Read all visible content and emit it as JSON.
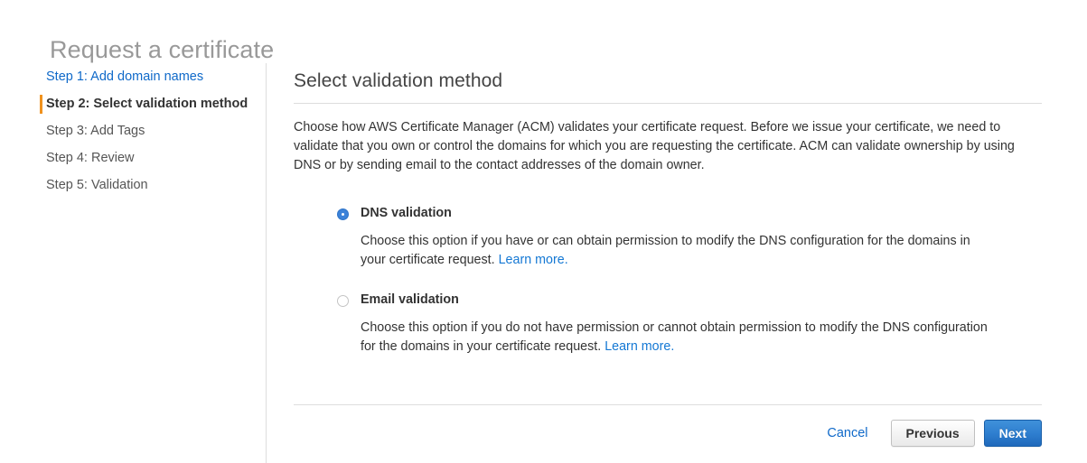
{
  "page": {
    "title": "Request a certificate"
  },
  "steps": [
    {
      "label": "Step 1: Add domain names",
      "state": "link"
    },
    {
      "label": "Step 2: Select validation method",
      "state": "current"
    },
    {
      "label": "Step 3: Add Tags",
      "state": "upcoming"
    },
    {
      "label": "Step 4: Review",
      "state": "upcoming"
    },
    {
      "label": "Step 5: Validation",
      "state": "upcoming"
    }
  ],
  "content": {
    "heading": "Select validation method",
    "intro": "Choose how AWS Certificate Manager (ACM) validates your certificate request. Before we issue your certificate, we need to validate that you own or control the domains for which you are requesting the certificate. ACM can validate ownership by using DNS or by sending email to the contact addresses of the domain owner."
  },
  "options": [
    {
      "id": "dns-validation",
      "label": "DNS validation",
      "selected": true,
      "description": "Choose this option if you have or can obtain permission to modify the DNS configuration for the domains in your certificate request.",
      "link_text": "Learn more."
    },
    {
      "id": "email-validation",
      "label": "Email validation",
      "selected": false,
      "description": "Choose this option if you do not have permission or cannot obtain permission to modify the DNS configuration for the domains in your certificate request.",
      "link_text": "Learn more."
    }
  ],
  "footer": {
    "cancel_label": "Cancel",
    "previous_label": "Previous",
    "next_label": "Next"
  },
  "colors": {
    "link_blue": "#0f69c9",
    "inline_link_blue": "#1478d4",
    "current_step_marker_orange": "#f0921e",
    "primary_button_blue": "#2f7fd0",
    "title_gray": "#999999",
    "divider_gray": "#dddddd"
  }
}
